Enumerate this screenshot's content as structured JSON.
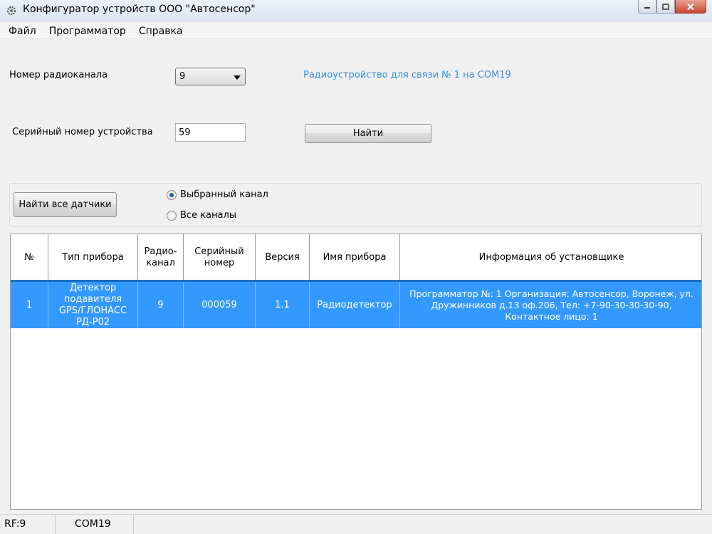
{
  "window": {
    "title": "Конфигуратор устройств ООО \"Автосенсор\""
  },
  "menu": [
    "Файл",
    "Программатор",
    "Справка"
  ],
  "radio_channel": {
    "label": "Номер радиоканала",
    "value": "9"
  },
  "radio_device_info": "Радиоустройство для связи № 1 на COM19",
  "serial": {
    "label": "Серийный номер устройства",
    "value": "59"
  },
  "find_button": "Найти",
  "find_all_button": "Найти все датчики",
  "radio_options": [
    {
      "label": "Выбранный канал",
      "checked": true
    },
    {
      "label": "Все каналы",
      "checked": false
    }
  ],
  "table": {
    "headers": [
      "№",
      "Тип прибора",
      "Радио-канал",
      "Серийный номер",
      "Версия",
      "Имя прибора",
      "Информация об установщике"
    ],
    "rows": [
      [
        "1",
        "Детектор подавителя GPS/ГЛОНАСС РД-Р02",
        "9",
        "000059",
        "1.1",
        "Радиодетектор",
        "Программатор №: 1  Организация: Автосенсор, Воронеж,  ул. Дружинников д.13  оф.206, Тел: +7-90-30-30-30-90, Контактное лицо: 1"
      ]
    ]
  },
  "status": {
    "rf": "RF:9",
    "port": "COM19"
  }
}
